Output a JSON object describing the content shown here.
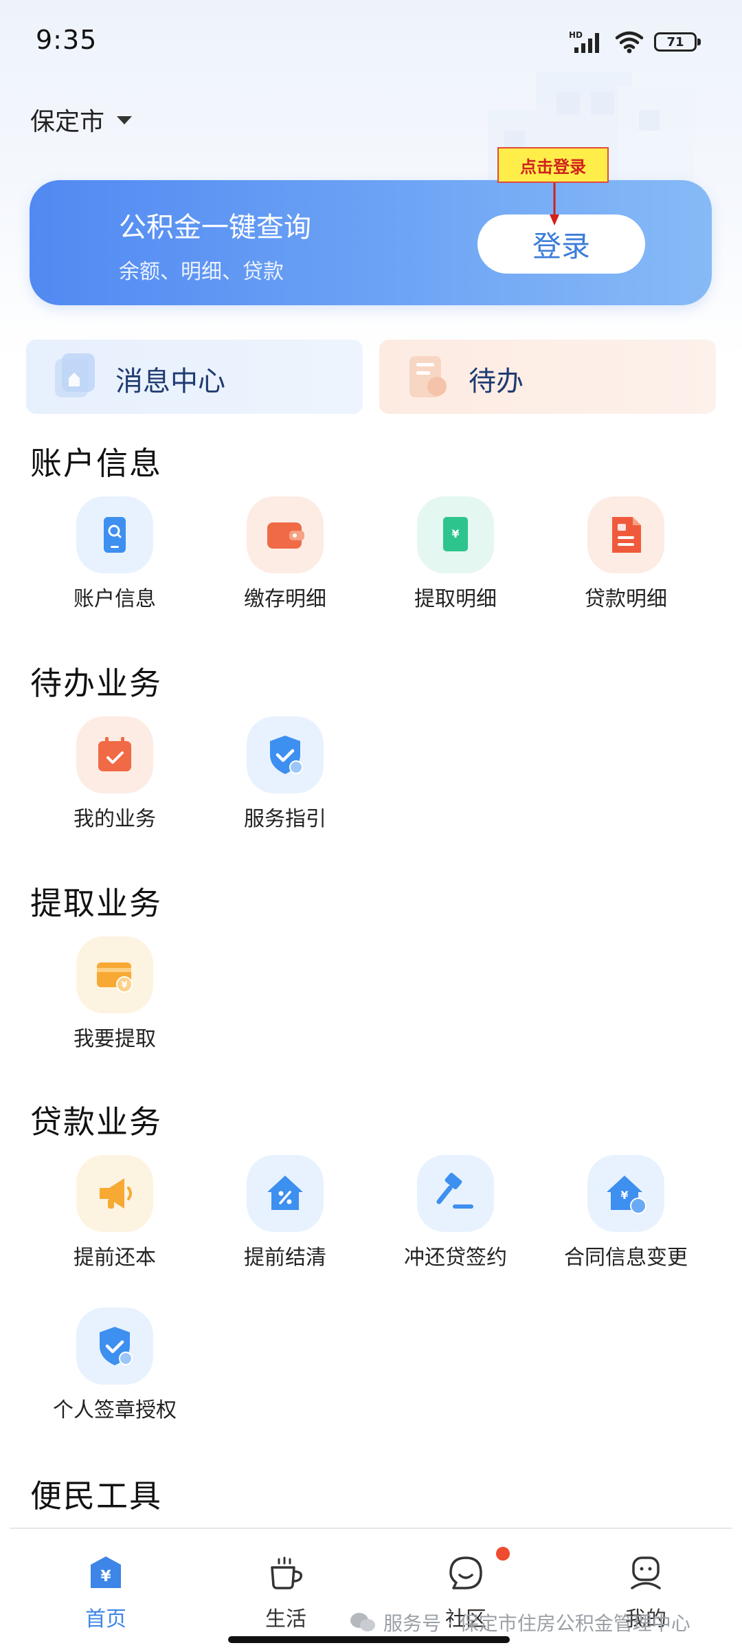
{
  "status_bar": {
    "time": "9:35",
    "network": "HD",
    "battery": "71",
    "icons": [
      "signal-icon",
      "wifi-icon",
      "battery-icon"
    ]
  },
  "location": {
    "city": "保定市",
    "icon": "chevron-down-icon"
  },
  "login_banner": {
    "title": "公积金一键查询",
    "subtitle": "余额、明细、贷款",
    "button_label": "登录",
    "annotation": "点击登录",
    "colors": {
      "gradient_start": "#5189f2",
      "gradient_end": "#86baf6",
      "button_text": "#3c7cd9",
      "annotation_bg": "#ffee4a",
      "annotation_text": "#d1211b"
    }
  },
  "quick_cards": [
    {
      "label": "消息中心",
      "icon": "message-center-icon"
    },
    {
      "label": "待办",
      "icon": "todo-document-icon"
    }
  ],
  "sections": [
    {
      "title": "账户信息",
      "items": [
        {
          "label": "账户信息",
          "icon": "phone-search-icon"
        },
        {
          "label": "缴存明细",
          "icon": "wallet-icon"
        },
        {
          "label": "提取明细",
          "icon": "yuan-card-icon"
        },
        {
          "label": "贷款明细",
          "icon": "loan-document-icon"
        }
      ]
    },
    {
      "title": "待办业务",
      "items": [
        {
          "label": "我的业务",
          "icon": "calendar-check-icon"
        },
        {
          "label": "服务指引",
          "icon": "shield-check-icon"
        }
      ]
    },
    {
      "title": "提取业务",
      "items": [
        {
          "label": "我要提取",
          "icon": "card-yuan-icon"
        }
      ]
    },
    {
      "title": "贷款业务",
      "items": [
        {
          "label": "提前还本",
          "icon": "megaphone-icon"
        },
        {
          "label": "提前结清",
          "icon": "house-percent-icon"
        },
        {
          "label": "冲还贷签约",
          "icon": "gavel-icon"
        },
        {
          "label": "合同信息变更",
          "icon": "house-loan-icon"
        },
        {
          "label": "个人签章授权",
          "icon": "shield-check-icon"
        }
      ]
    },
    {
      "title": "便民工具",
      "items": []
    }
  ],
  "bottom_nav": [
    {
      "label": "首页",
      "icon": "home-yuan-icon",
      "active": true
    },
    {
      "label": "生活",
      "icon": "cup-icon",
      "active": false
    },
    {
      "label": "社区",
      "icon": "chat-bubble-icon",
      "active": false,
      "badge": true
    },
    {
      "label": "我的",
      "icon": "profile-icon",
      "active": false
    }
  ],
  "watermark": "服务号 · 保定市住房公积金管理中心"
}
